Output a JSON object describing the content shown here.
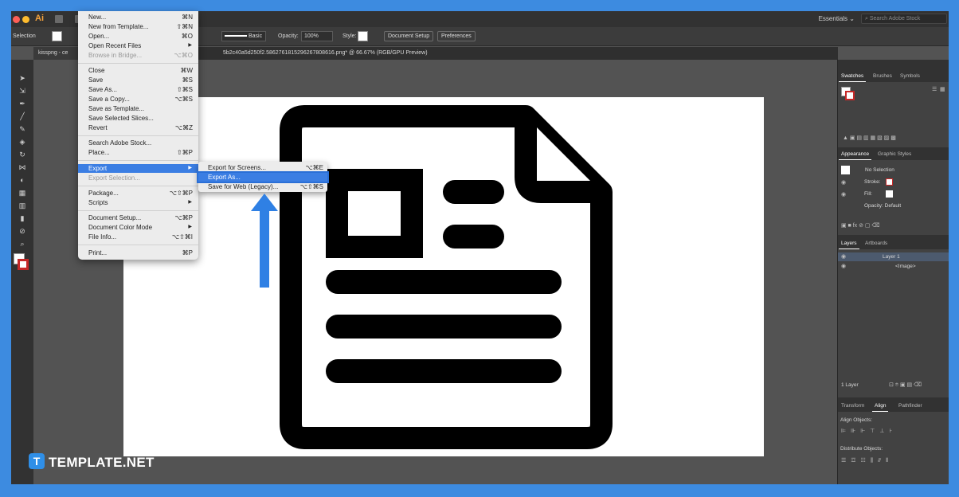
{
  "app": {
    "logo": "Ai",
    "workspace": "Essentials",
    "search_placeholder": "Search Adobe Stock"
  },
  "controlbar": {
    "selection_label": "Selection",
    "stroke_style": "Basic",
    "opacity_label": "Opacity:",
    "opacity_value": "100%",
    "style_label": "Style:",
    "document_setup": "Document Setup",
    "preferences": "Preferences"
  },
  "tabs": [
    {
      "label": "kissp.png @ 69...",
      "short": "kissp­ng - ce"
    },
    {
      "label": "5b2c40a5d250f2.5862761815296267808616.png* @ 66.67% (RGB/GPU Preview)"
    }
  ],
  "file_menu": {
    "items": [
      {
        "label": "New...",
        "shortcut": "⌘N"
      },
      {
        "label": "New from Template...",
        "shortcut": "⇧⌘N"
      },
      {
        "label": "Open...",
        "shortcut": "⌘O"
      },
      {
        "label": "Open Recent Files",
        "shortcut": "▶"
      },
      {
        "label": "Browse in Bridge...",
        "shortcut": "⌥⌘O"
      },
      {
        "label": "Close",
        "shortcut": "⌘W"
      },
      {
        "label": "Save",
        "shortcut": "⌘S"
      },
      {
        "label": "Save As...",
        "shortcut": "⇧⌘S"
      },
      {
        "label": "Save a Copy...",
        "shortcut": "⌥⌘S"
      },
      {
        "label": "Save as Template..."
      },
      {
        "label": "Save Selected Slices..."
      },
      {
        "label": "Revert",
        "shortcut": "⌥⌘Z"
      },
      {
        "label": "Search Adobe Stock..."
      },
      {
        "label": "Place...",
        "shortcut": "⇧⌘P"
      },
      {
        "label": "Export",
        "shortcut": "▶"
      },
      {
        "label": "Export Selection..."
      },
      {
        "label": "Package...",
        "shortcut": "⌥⇧⌘P"
      },
      {
        "label": "Scripts",
        "shortcut": "▶"
      },
      {
        "label": "Document Setup...",
        "shortcut": "⌥⌘P"
      },
      {
        "label": "Document Color Mode",
        "shortcut": "▶"
      },
      {
        "label": "File Info...",
        "shortcut": "⌥⇧⌘I"
      },
      {
        "label": "Print...",
        "shortcut": "⌘P"
      }
    ]
  },
  "export_submenu": {
    "items": [
      {
        "label": "Export for Screens...",
        "shortcut": "⌥⌘E"
      },
      {
        "label": "Export As..."
      },
      {
        "label": "Save for Web (Legacy)...",
        "shortcut": "⌥⇧⌘S"
      }
    ]
  },
  "panels": {
    "swatches_tabs": [
      "Swatches",
      "Brushes",
      "Symbols"
    ],
    "appearance_tabs": [
      "Appearance",
      "Graphic Styles"
    ],
    "appearance": {
      "no_selection": "No Selection",
      "stroke": "Stroke:",
      "fill": "Fill:",
      "opacity": "Opacity: Default"
    },
    "layers_tabs": [
      "Layers",
      "Artboards"
    ],
    "layers": {
      "layer1": "Layer 1",
      "image": "<Image>",
      "count": "1 Layer"
    },
    "bottom_tabs": [
      "Transform",
      "Align",
      "Pathfinder"
    ],
    "align": {
      "align_objects": "Align Objects:",
      "distribute_objects": "Distribute Objects:"
    }
  },
  "watermark": {
    "icon_letter": "T",
    "text": "TEMPLATE.NET"
  },
  "colors": {
    "frame_blue": "#3d8be0",
    "menu_highlight": "#3b7ee3",
    "arrow": "#2f80e4",
    "brand": "#2f8fe8"
  }
}
